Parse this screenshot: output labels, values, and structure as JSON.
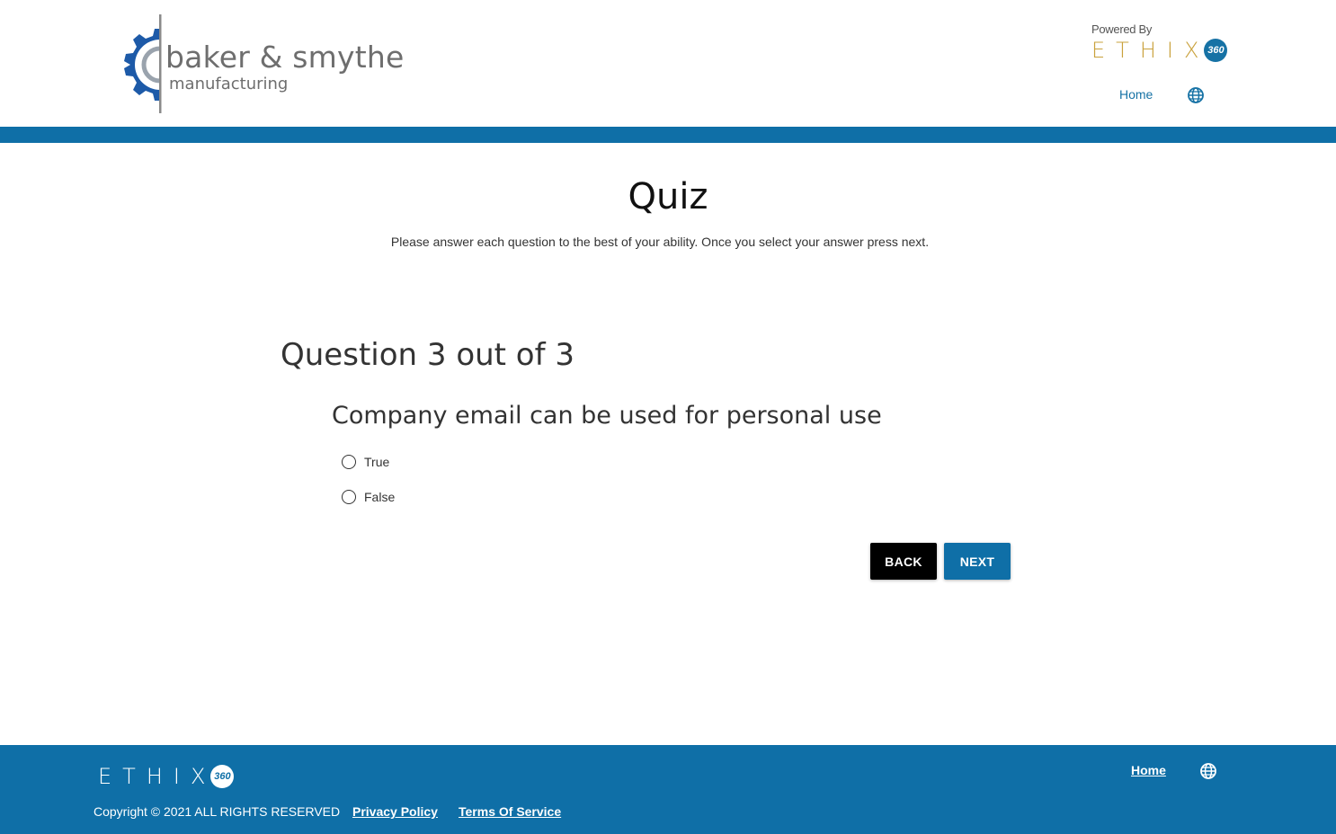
{
  "header": {
    "brand_name": "baker & smythe",
    "brand_sub": "manufacturing",
    "powered_by": "Powered By",
    "ethix_word": "ETHIX",
    "ethix_badge": "360",
    "nav_home": "Home",
    "globe_icon": "globe-icon"
  },
  "main": {
    "title": "Quiz",
    "instructions": "Please answer each question to the best of your ability. Once you select your answer press next.",
    "question_heading": "Question 3 out of 3",
    "question_text": "Company email can be used for personal use",
    "options": [
      {
        "label": "True"
      },
      {
        "label": "False"
      }
    ],
    "back_label": "BACK",
    "next_label": "NEXT"
  },
  "footer": {
    "ethix_word": "ETHIX",
    "ethix_badge": "360",
    "copyright": "Copyright © 2021 ALL RIGHTS RESERVED",
    "privacy": "Privacy Policy",
    "terms": "Terms Of Service",
    "home": "Home"
  },
  "colors": {
    "brand_blue": "#0f6fa7",
    "gear_blue": "#1d5aa8",
    "ethix_gold": "#c9a13b",
    "back_button": "#000000"
  }
}
